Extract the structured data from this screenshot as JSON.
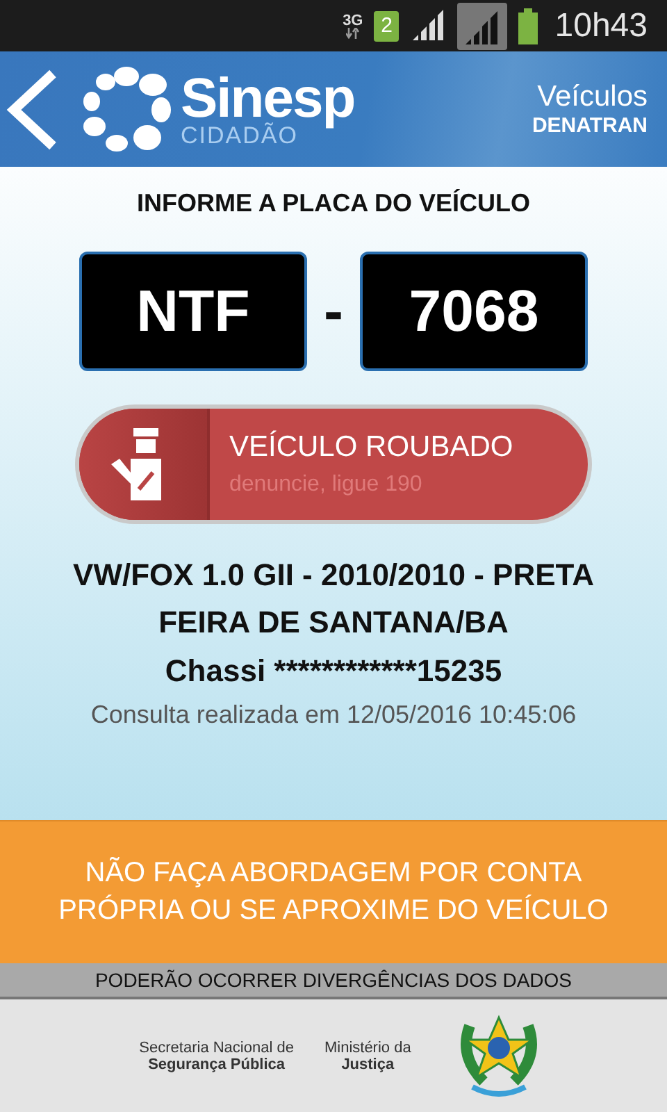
{
  "status_bar": {
    "network": "3G",
    "sim": "2",
    "time": "10h43"
  },
  "header": {
    "logo_title": "Sinesp",
    "logo_subtitle": "CIDADÃO",
    "section": "Veículos",
    "agency": "DENATRAN"
  },
  "plate": {
    "prompt": "INFORME A PLACA DO VEÍCULO",
    "letters": "NTF",
    "separator": "-",
    "digits": "7068"
  },
  "alert": {
    "kind": "stolen",
    "title": "VEÍCULO ROUBADO",
    "subtitle": "denuncie, ligue 190"
  },
  "vehicle": {
    "model": "VW/FOX 1.0 GII - 2010/2010 - PRETA",
    "city": "FEIRA DE SANTANA/BA",
    "chassis": "Chassi ************15235",
    "consulted": "Consulta realizada em 12/05/2016 10:45:06"
  },
  "warning": "NÃO FAÇA ABORDAGEM POR CONTA PRÓPRIA OU SE APROXIME DO VEÍCULO",
  "disclaimer": "PODERÃO OCORRER DIVERGÊNCIAS DOS DADOS",
  "footer": {
    "orgs": [
      {
        "line1": "Secretaria Nacional de",
        "line2": "Segurança Pública"
      },
      {
        "line1": "Ministério da",
        "line2": "Justiça"
      }
    ]
  }
}
